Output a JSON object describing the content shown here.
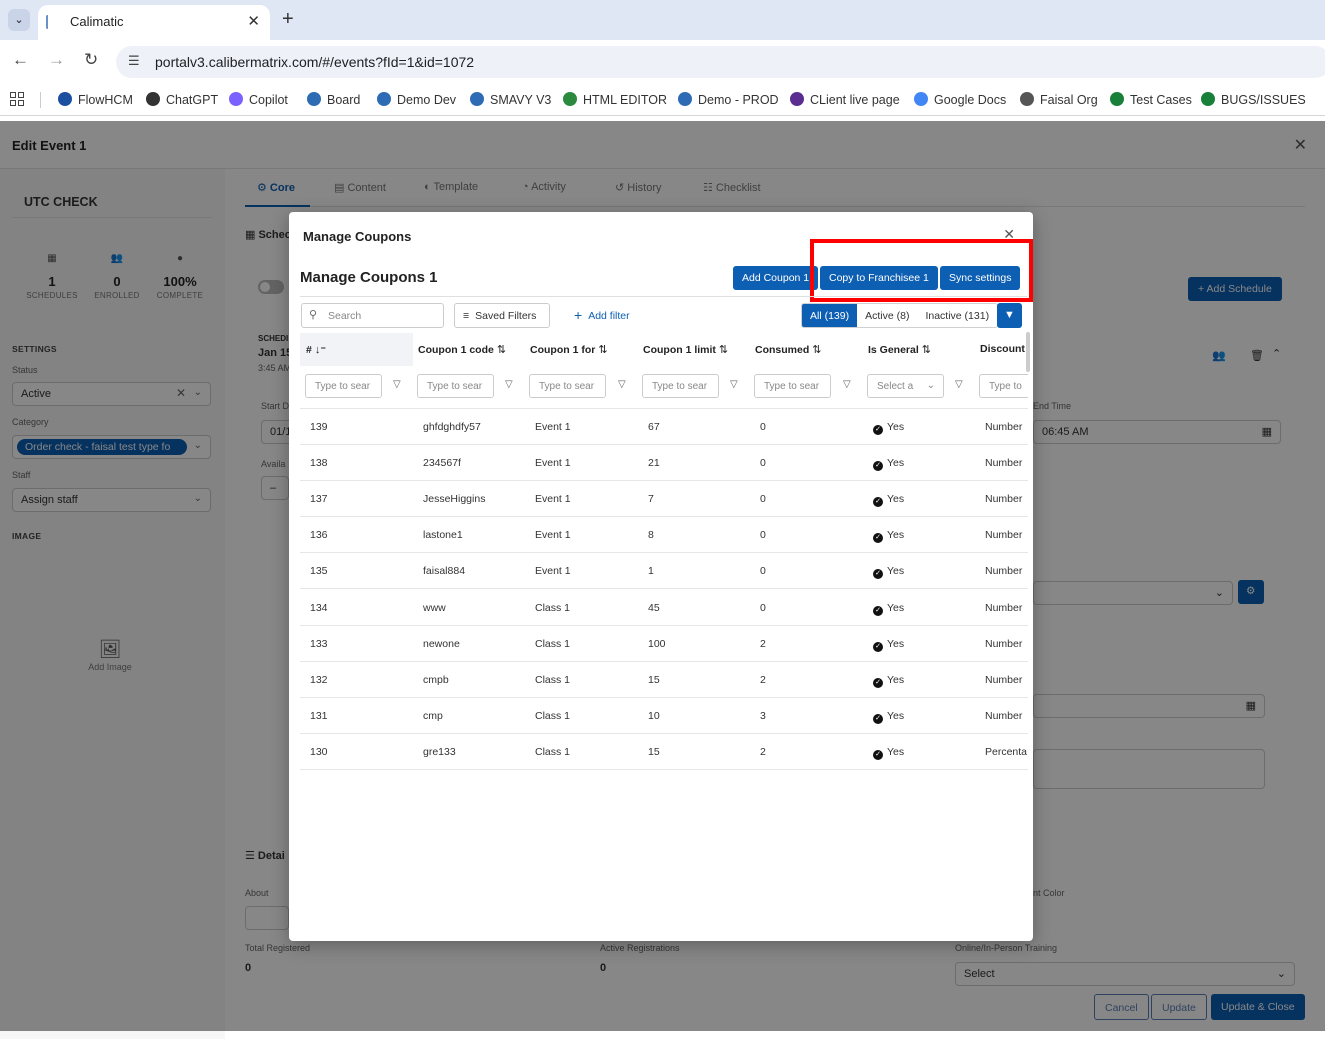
{
  "browser": {
    "tab_title": "Calimatic",
    "url": "portalv3.calibermatrix.com/#/events?fId=1&id=1072",
    "bookmarks": [
      {
        "label": "FlowHCM",
        "color": "#1b4fa0"
      },
      {
        "label": "ChatGPT",
        "color": "#333333"
      },
      {
        "label": "Copilot",
        "color": "#7b61ff"
      },
      {
        "label": "Board",
        "color": "#2d6cb5"
      },
      {
        "label": "Demo Dev",
        "color": "#2d6cb5"
      },
      {
        "label": "SMAVY V3",
        "color": "#2d6cb5"
      },
      {
        "label": "HTML EDITOR",
        "color": "#2b8a3e"
      },
      {
        "label": "Demo - PROD",
        "color": "#2d6cb5"
      },
      {
        "label": "CLient live page",
        "color": "#5b2d90"
      },
      {
        "label": "Google Docs",
        "color": "#4285f4"
      },
      {
        "label": "Faisal Org",
        "color": "#555555"
      },
      {
        "label": "Test Cases",
        "color": "#188038"
      },
      {
        "label": "BUGS/ISSUES",
        "color": "#188038"
      }
    ]
  },
  "app": {
    "title": "Edit Event 1",
    "sidebar": {
      "event_name": "UTC CHECK",
      "stats": [
        {
          "value": "1",
          "label": "SCHEDULES",
          "icon": "calendar-icon"
        },
        {
          "value": "0",
          "label": "ENROLLED",
          "icon": "users-icon"
        },
        {
          "value": "100%",
          "label": "COMPLETE",
          "icon": "check-circle-icon"
        }
      ],
      "settings_heading": "SETTINGS",
      "status_label": "Status",
      "status_value": "Active",
      "category_label": "Category",
      "category_value": "Order check - faisal test type fo",
      "staff_label": "Staff",
      "staff_placeholder": "Assign staff",
      "image_heading": "IMAGE",
      "add_image": "Add Image"
    },
    "tabs": [
      "Core",
      "Content",
      "Template",
      "Activity",
      "History",
      "Checklist"
    ],
    "background": {
      "schedule_heading": "Schec",
      "add_schedule": "+ Add Schedule",
      "sched_label": "SCHEDI",
      "sched_date": "Jan 15",
      "sched_time": "3:45 AM",
      "start_label": "Start D",
      "start_value": "01/1!",
      "avail_label": "Availa",
      "end_time_label": "End Time",
      "end_time_value": "06:45 AM",
      "details_heading": "Detai",
      "about_label": "About",
      "event_color_label": "nt Color",
      "total_registered_label": "Total Registered",
      "total_registered_value": "0",
      "active_reg_label": "Active Registrations",
      "active_reg_value": "0",
      "training_label": "Online/In-Person Training",
      "training_value": "Select",
      "cancel": "Cancel",
      "update": "Update",
      "update_close": "Update & Close"
    }
  },
  "modal": {
    "title": "Manage Coupons",
    "subtitle": "Manage Coupons 1",
    "buttons": {
      "add_coupon": "Add Coupon 1",
      "copy_franchisee": "Copy to Franchisee 1",
      "sync_settings": "Sync settings"
    },
    "search_placeholder": "Search",
    "saved_filters": "Saved Filters",
    "add_filter": "Add filter",
    "segments": [
      {
        "label": "All (139)",
        "active": true
      },
      {
        "label": "Active (8)",
        "active": false
      },
      {
        "label": "Inactive (131)",
        "active": false
      }
    ],
    "columns": [
      "#",
      "Coupon 1 code",
      "Coupon 1 for",
      "Coupon 1 limit",
      "Consumed",
      "Is General",
      "Discount"
    ],
    "filter_placeholder": "Type to sear",
    "filter_select_placeholder": "Select a",
    "filter_last_placeholder": "Type to",
    "rows": [
      {
        "id": "139",
        "code": "ghfdghdfy57",
        "for": "Event 1",
        "limit": "67",
        "consumed": "0",
        "general": "Yes",
        "discount": "Number"
      },
      {
        "id": "138",
        "code": "234567f",
        "for": "Event 1",
        "limit": "21",
        "consumed": "0",
        "general": "Yes",
        "discount": "Number"
      },
      {
        "id": "137",
        "code": "JesseHiggins",
        "for": "Event 1",
        "limit": "7",
        "consumed": "0",
        "general": "Yes",
        "discount": "Number"
      },
      {
        "id": "136",
        "code": "lastone1",
        "for": "Event 1",
        "limit": "8",
        "consumed": "0",
        "general": "Yes",
        "discount": "Number"
      },
      {
        "id": "135",
        "code": "faisal884",
        "for": "Event 1",
        "limit": "1",
        "consumed": "0",
        "general": "Yes",
        "discount": "Number"
      },
      {
        "id": "134",
        "code": "www",
        "for": "Class 1",
        "limit": "45",
        "consumed": "0",
        "general": "Yes",
        "discount": "Number"
      },
      {
        "id": "133",
        "code": "newone",
        "for": "Class 1",
        "limit": "100",
        "consumed": "2",
        "general": "Yes",
        "discount": "Number"
      },
      {
        "id": "132",
        "code": "cmpb",
        "for": "Class 1",
        "limit": "15",
        "consumed": "2",
        "general": "Yes",
        "discount": "Number"
      },
      {
        "id": "131",
        "code": "cmp",
        "for": "Class 1",
        "limit": "10",
        "consumed": "3",
        "general": "Yes",
        "discount": "Number"
      },
      {
        "id": "130",
        "code": "gre133",
        "for": "Class 1",
        "limit": "15",
        "consumed": "2",
        "general": "Yes",
        "discount": "Percenta"
      }
    ]
  }
}
